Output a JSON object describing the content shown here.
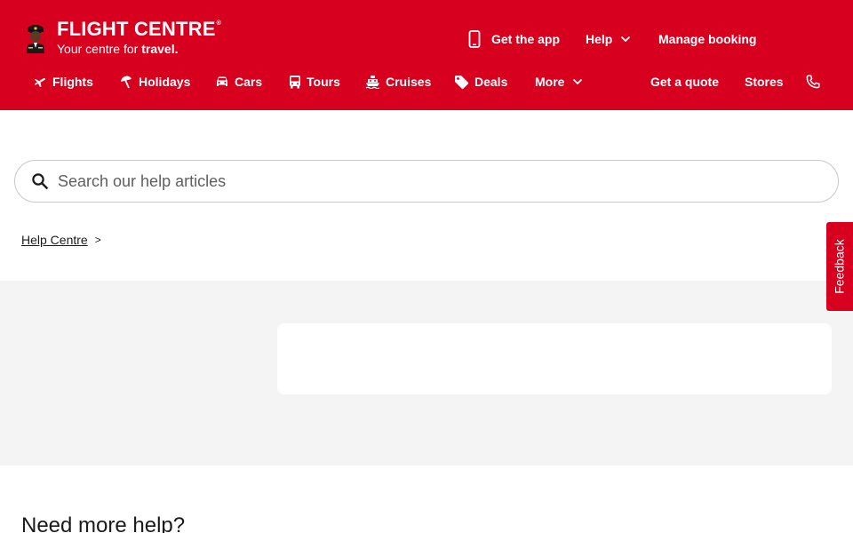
{
  "header": {
    "brand": "FLIGHT CENTRE",
    "brand_reg": "®",
    "tagline_prefix": "Your centre for",
    "tagline_bold": "travel.",
    "bg_color": "#d7001e"
  },
  "top_links": {
    "get_app": "Get the app",
    "help": "Help",
    "manage_booking": "Manage booking"
  },
  "nav": {
    "items": [
      {
        "label": "Flights",
        "icon": "plane-icon"
      },
      {
        "label": "Holidays",
        "icon": "beach-umbrella-icon"
      },
      {
        "label": "Cars",
        "icon": "car-icon"
      },
      {
        "label": "Tours",
        "icon": "bus-icon"
      },
      {
        "label": "Cruises",
        "icon": "ship-icon"
      },
      {
        "label": "Deals",
        "icon": "tag-icon"
      },
      {
        "label": "More",
        "icon": "chevron-down-icon"
      }
    ],
    "get_quote": "Get a quote",
    "stores": "Stores",
    "phone_icon": "phone-icon"
  },
  "search": {
    "placeholder": "Search our help articles",
    "value": ""
  },
  "breadcrumb": {
    "items": [
      "Help Centre"
    ],
    "separator": ">"
  },
  "feedback": {
    "label": "Feedback"
  },
  "footer_section": {
    "heading": "Need more help?"
  }
}
